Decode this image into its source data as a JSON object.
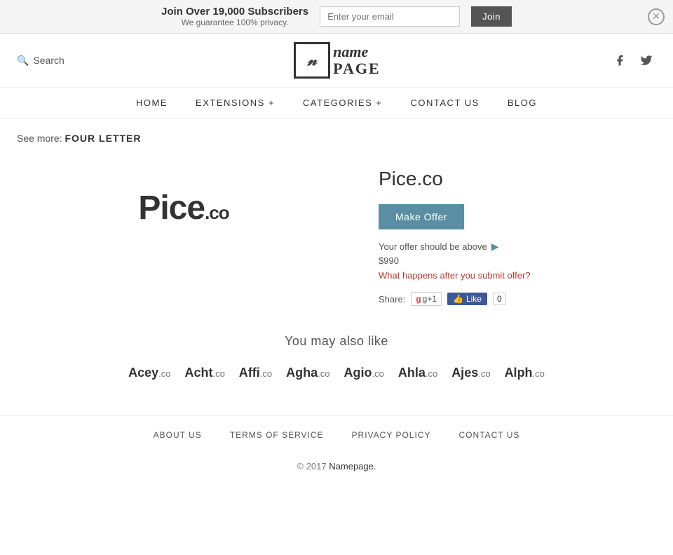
{
  "banner": {
    "main_text": "Join Over 19,000 Subscribers",
    "sub_text": "We guarantee 100% privacy.",
    "email_placeholder": "Enter your email",
    "join_label": "Join"
  },
  "header": {
    "search_label": "Search",
    "logo_letter": "n",
    "logo_name": "name",
    "logo_page": "PAGE",
    "facebook_icon": "f",
    "twitter_icon": "t"
  },
  "nav": {
    "items": [
      {
        "label": "HOME"
      },
      {
        "label": "EXTENSIONS +"
      },
      {
        "label": "CATEGORIES +"
      },
      {
        "label": "CONTACT US"
      },
      {
        "label": "BLOG"
      }
    ]
  },
  "breadcrumb": {
    "see_more": "See more:",
    "link_text": "FOUR LETTER"
  },
  "domain": {
    "name": "Pice",
    "tld": ".co",
    "full": "Pice.co",
    "make_offer_label": "Make Offer",
    "offer_note": "Your offer should be above",
    "offer_price": "$990",
    "what_happens": "What happens after you submit offer?",
    "share_label": "Share:",
    "gplus_label": "g+1",
    "fb_label": "Like",
    "fb_count": "0"
  },
  "also_like": {
    "title": "You may also like",
    "domains": [
      {
        "name": "Acey",
        "tld": ".co"
      },
      {
        "name": "Acht",
        "tld": ".co"
      },
      {
        "name": "Affi",
        "tld": ".co"
      },
      {
        "name": "Agha",
        "tld": ".co"
      },
      {
        "name": "Agio",
        "tld": ".co"
      },
      {
        "name": "Ahla",
        "tld": ".co"
      },
      {
        "name": "Ajes",
        "tld": ".co"
      },
      {
        "name": "Alph",
        "tld": ".co"
      }
    ]
  },
  "footer": {
    "links": [
      {
        "label": "ABOUT US"
      },
      {
        "label": "TERMS OF SERVICE"
      },
      {
        "label": "PRIVACY POLICY"
      },
      {
        "label": "CONTACT US"
      }
    ],
    "copy": "© 2017",
    "brand": "Namepage."
  }
}
